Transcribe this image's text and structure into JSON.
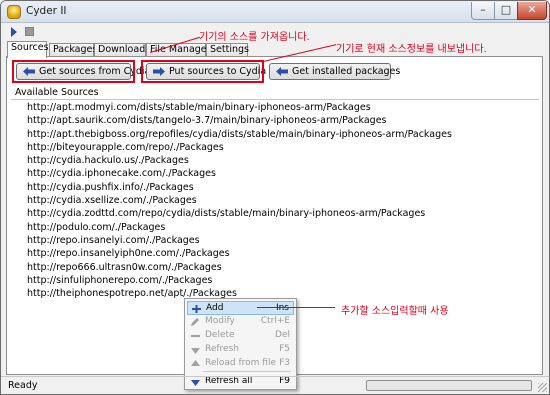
{
  "window": {
    "title": "Cyder II"
  },
  "title_buttons": {
    "minimize": "–",
    "maximize": "□",
    "close": "✕"
  },
  "tabs": [
    "Sources",
    "Packages",
    "Downloads",
    "File Manager",
    "Settings"
  ],
  "buttons": {
    "get_from_cydia": "Get sources from Cydia",
    "put_to_cydia": "Put sources to Cydia",
    "get_installed": "Get installed packages"
  },
  "annotations": {
    "get_sources": "기기의 소스를 가져옵니다.",
    "put_sources": "기기로 현재 소스정보를 내보냅니다.",
    "add_source": "추가할 소스입력할때 사용"
  },
  "list": {
    "header": "Available Sources",
    "sources": [
      "http://apt.modmyi.com/dists/stable/main/binary-iphoneos-arm/Packages",
      "http://apt.saurik.com/dists/tangelo-3.7/main/binary-iphoneos-arm/Packages",
      "http://apt.thebigboss.org/repofiles/cydia/dists/stable/main/binary-iphoneos-arm/Packages",
      "http://biteyourapple.com/repo/./Packages",
      "http://cydia.hackulo.us/./Packages",
      "http://cydia.iphonecake.com/./Packages",
      "http://cydia.pushfix.info/./Packages",
      "http://cydia.xsellize.com/./Packages",
      "http://cydia.zodttd.com/repo/cydia/dists/stable/main/binary-iphoneos-arm/Packages",
      "http://podulo.com/./Packages",
      "http://repo.insanelyi.com/./Packages",
      "http://repo.insanelyiph0ne.com/./Packages",
      "http://repo666.ultrasn0w.com/./Packages",
      "http://sinfuliphonerepo.com/./Packages",
      "http://theiphonespotrepo.net/apt/./Packages"
    ]
  },
  "context_menu": [
    {
      "label": "Add",
      "shortcut": "Ins",
      "icon": "plus-icon"
    },
    {
      "label": "Modify",
      "shortcut": "Ctrl+E",
      "icon": "pencil-icon"
    },
    {
      "label": "Delete",
      "shortcut": "Del",
      "icon": "minus-icon"
    },
    {
      "label": "Refresh",
      "shortcut": "F5",
      "icon": "refresh-icon"
    },
    {
      "label": "Reload from file",
      "shortcut": "F3",
      "icon": "reload-icon"
    },
    {
      "label": "Refresh all",
      "shortcut": "F9",
      "icon": "refresh-all-icon"
    }
  ],
  "status": {
    "text": "Ready",
    "progress": 0
  },
  "colors": {
    "annotation_red": "#e0001b",
    "arrow_blue": "#2a4fa8",
    "menu_selected": "#cde4f7"
  }
}
